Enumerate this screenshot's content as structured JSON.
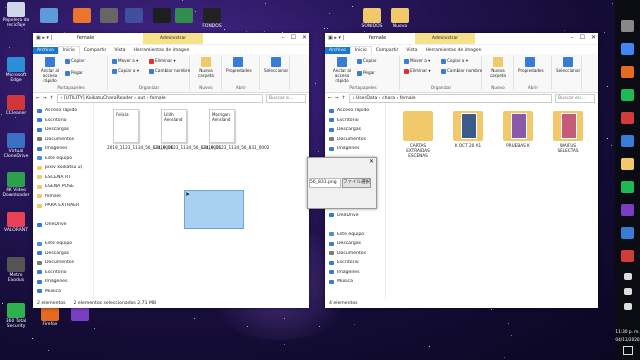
{
  "desktop": {
    "icons_left": [
      {
        "label": "Papelera de reciclaje",
        "color": "#cfd8e8"
      },
      {
        "label": "Microsoft Edge",
        "color": "#2c8fd6"
      },
      {
        "label": "CCleaner",
        "color": "#d0363a"
      },
      {
        "label": "Virtual CloneDrive",
        "color": "#3a6fc4"
      },
      {
        "label": "4K Video Downloader",
        "color": "#2aa14c"
      },
      {
        "label": "VALORANT",
        "color": "#e84057"
      },
      {
        "label": "Metro Exodus",
        "color": "#555555"
      },
      {
        "label": "360 Total Security",
        "color": "#2bb24c"
      }
    ],
    "icons_top": [
      {
        "label": "",
        "color": "#5e9ad6"
      },
      {
        "label": "",
        "color": "#e8762c"
      },
      {
        "label": "",
        "color": "#666666"
      },
      {
        "label": "",
        "color": "#3f4f9e"
      },
      {
        "label": "",
        "color": "#1e1e1e"
      },
      {
        "label": "",
        "color": "#2f8d4e"
      },
      {
        "label": "FONDOS",
        "color": "#222222"
      },
      {
        "label": "SONIDOS",
        "color": "#f1c96a"
      },
      {
        "label": "Nueva",
        "color": "#f1c96a"
      }
    ],
    "icons_bottom": [
      {
        "label": "Firefox",
        "color": "#e66a1f"
      },
      {
        "label": "",
        "color": "#7a3fc0"
      }
    ]
  },
  "left_window": {
    "qa_toolbar": "▣ ▸ ▾ |",
    "title": "female",
    "tool_tab": "Administrar",
    "tabs": [
      "Archivo",
      "Inicio",
      "Compartir",
      "Vista",
      "Herramientas de imagen"
    ],
    "ribbon": {
      "groups": [
        {
          "label": "Portapapeles",
          "items": [
            "Anclar al acceso rápido",
            "Copiar",
            "Pegar"
          ]
        },
        {
          "label": "Organizar",
          "items": [
            "Mover a ▾",
            "Copiar a ▾",
            "Eliminar ▾",
            "Cambiar nombre"
          ]
        },
        {
          "label": "Nuevo",
          "items": [
            "Nueva carpeta"
          ]
        },
        {
          "label": "Abrir",
          "items": [
            "Propiedades"
          ]
        },
        {
          "label": "",
          "items": [
            "Seleccionar"
          ]
        }
      ]
    },
    "path": "› [UTILITY] KoikatuCharaReader › out › female",
    "search_placeholder": "Buscar e...",
    "nav": [
      {
        "label": "Acceso rápido",
        "color": "#3a7bd5"
      },
      {
        "label": "Escritorio",
        "color": "#3a7bd5"
      },
      {
        "label": "Descargas",
        "color": "#3a7bd5"
      },
      {
        "label": "Documentos",
        "color": "#7a7a7a"
      },
      {
        "label": "Imágenes",
        "color": "#3a7bd5"
      },
      {
        "label": "Este equipo",
        "color": "#4b8fd6"
      },
      {
        "label": "pixiv koikatsu 2(",
        "color": "#f1c96a"
      },
      {
        "label": "ESCENA RT",
        "color": "#f1c96a"
      },
      {
        "label": "ESENA POSE",
        "color": "#f1c96a"
      },
      {
        "label": "female",
        "color": "#f1c96a"
      },
      {
        "label": "PARA EXTRAER",
        "color": "#f1c96a"
      },
      {
        "label": "",
        "color": "#ffffff"
      },
      {
        "label": "OneDrive",
        "color": "#2c7cd6"
      },
      {
        "label": "",
        "color": "#ffffff"
      },
      {
        "label": "Este equipo",
        "color": "#4b8fd6"
      },
      {
        "label": "Descargas",
        "color": "#3a7bd5"
      },
      {
        "label": "Documentos",
        "color": "#7a7a7a"
      },
      {
        "label": "Escritorio",
        "color": "#3a7bd5"
      },
      {
        "label": "Imágenes",
        "color": "#3a7bd5"
      },
      {
        "label": "Música",
        "color": "#3a7bd5"
      }
    ],
    "files": [
      {
        "name": "2019_1123_1134_56_831_0000",
        "card": "Felicia"
      },
      {
        "name": "2019_1123_1134_56_831_0001",
        "card": "Lilith Aensland"
      },
      {
        "name": "2019_1123_1134_56_831_0002",
        "card": "Morrigan Aensland"
      }
    ],
    "status": [
      "2 elementos",
      "2 elementos seleccionados 2,71 MB"
    ]
  },
  "drag_dialog": {
    "filename": "56_831.png",
    "button": "ファイル選択"
  },
  "right_window": {
    "title": "female",
    "tool_tab": "Administrar",
    "tabs": [
      "Archivo",
      "Inicio",
      "Compartir",
      "Vista",
      "Herramientas de imagen"
    ],
    "ribbon": {
      "groups": [
        {
          "label": "Portapapeles",
          "items": [
            "Anclar al acceso rápido",
            "Copiar",
            "Pegar"
          ]
        },
        {
          "label": "Organizar",
          "items": [
            "Mover a ▾",
            "Eliminar ▾",
            "Copiar a ▾",
            "Cambiar nombre"
          ]
        },
        {
          "label": "Nuevo",
          "items": [
            "Nueva carpeta"
          ]
        },
        {
          "label": "Abrir",
          "items": [
            "Propiedades"
          ]
        },
        {
          "label": "",
          "items": [
            "Seleccionar"
          ]
        }
      ]
    },
    "path": "› UserData › chara › female",
    "search_placeholder": "Buscar en...",
    "nav": [
      {
        "label": "Acceso rápido",
        "color": "#3a7bd5"
      },
      {
        "label": "Escritorio",
        "color": "#3a7bd5"
      },
      {
        "label": "Descargas",
        "color": "#3a7bd5"
      },
      {
        "label": "Documentos",
        "color": "#7a7a7a"
      },
      {
        "label": "Imágenes",
        "color": "#3a7bd5"
      },
      {
        "label": "",
        "color": "#ffffff"
      },
      {
        "label": "",
        "color": "#ffffff"
      },
      {
        "label": "",
        "color": "#ffffff"
      },
      {
        "label": "female",
        "color": "#f1c96a"
      },
      {
        "label": "PARA EXTRAER",
        "color": "#f1c96a"
      },
      {
        "label": "",
        "color": "#ffffff"
      },
      {
        "label": "OneDrive",
        "color": "#2c7cd6"
      },
      {
        "label": "",
        "color": "#ffffff"
      },
      {
        "label": "Este equipo",
        "color": "#4b8fd6"
      },
      {
        "label": "Descargas",
        "color": "#3a7bd5"
      },
      {
        "label": "Documentos",
        "color": "#7a7a7a"
      },
      {
        "label": "Escritorio",
        "color": "#3a7bd5"
      },
      {
        "label": "Imágenes",
        "color": "#3a7bd5"
      },
      {
        "label": "Música",
        "color": "#3a7bd5"
      }
    ],
    "folders": [
      {
        "name": "CARTAS EXTRAIDAS ESCENAS"
      },
      {
        "name": "K OCT 20 A1"
      },
      {
        "name": "PRUEBAS K"
      },
      {
        "name": "WAIFUS SELECTAS"
      }
    ],
    "status": [
      "4 elementos"
    ]
  },
  "taskbar": {
    "icons": [
      {
        "name": "chevron-up-icon",
        "color": "#888888"
      },
      {
        "name": "chrome-icon",
        "color": "#4285f4"
      },
      {
        "name": "firefox-icon",
        "color": "#e66a1f"
      },
      {
        "name": "spotify-icon",
        "color": "#1db954"
      },
      {
        "name": "app-icon",
        "color": "#d03c3c"
      },
      {
        "name": "chrome-icon",
        "color": "#3a7bd5"
      },
      {
        "name": "explorer-icon",
        "color": "#f1c96a"
      },
      {
        "name": "app-icon",
        "color": "#1db954"
      },
      {
        "name": "app-icon",
        "color": "#7a3fc0"
      },
      {
        "name": "store-icon",
        "color": "#3a7bd5"
      },
      {
        "name": "app-icon",
        "color": "#d03c3c"
      },
      {
        "name": "network-icon",
        "color": "#dddddd"
      },
      {
        "name": "volume-icon",
        "color": "#dddddd"
      },
      {
        "name": "battery-icon",
        "color": "#dddddd"
      }
    ],
    "time": "11:30 p. m.",
    "date": "04/11/2020"
  },
  "colors": {
    "file_tab": "#1979ca",
    "tool_tab": "#f5e28a",
    "selection": "#a9d0f0"
  }
}
